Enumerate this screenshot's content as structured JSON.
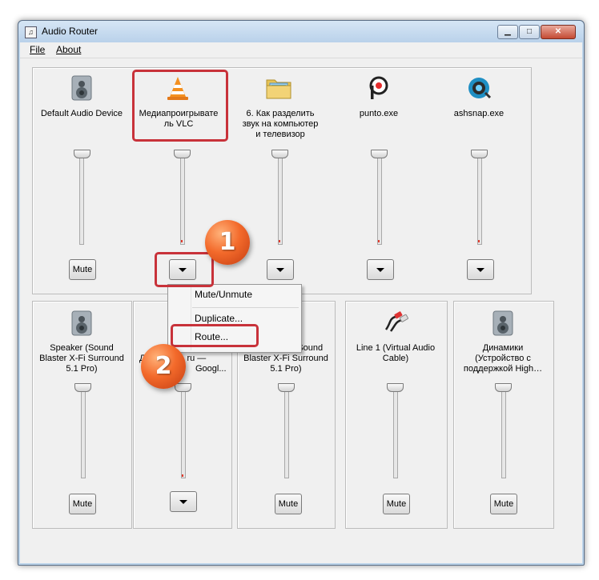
{
  "window": {
    "title": "Audio Router"
  },
  "menu": {
    "file": "File",
    "about": "About"
  },
  "top_devices": [
    {
      "name": "Default Audio Device",
      "control": "Mute",
      "icon": "speaker-icon"
    },
    {
      "name": "Медиапроигрыватель VLC",
      "line1": "Медиапроигрывате",
      "line2": "ль VLC",
      "control": "dropdown",
      "icon": "vlc-cone-icon"
    },
    {
      "name": "6. Как разделить звук на компьютер и телевизор",
      "line1": "6. Как разделить",
      "line2": "звук на компьютер",
      "line3": "и телевизор",
      "control": "dropdown",
      "icon": "folder-icon"
    },
    {
      "name": "punto.exe",
      "control": "dropdown",
      "icon": "punto-icon"
    },
    {
      "name": "ashsnap.exe",
      "control": "dropdown",
      "icon": "ashsnap-icon"
    }
  ],
  "bottom_devices": [
    {
      "line1": "Speaker (Sound",
      "line2": "Blaster X-Fi Surround",
      "line3": "5.1 Pro)",
      "control": "Mute",
      "icon": "speaker-icon"
    },
    {
      "line1": "Д",
      "line1b": "ru —",
      "line2": "Googl...",
      "control": "dropdown",
      "icon": "speaker-icon"
    },
    {
      "line1": "SPDIF-Out (Sound",
      "line2": "Blaster X-Fi Surround",
      "line3": "5.1 Pro)",
      "control": "Mute",
      "icon": "speaker-icon"
    },
    {
      "line1": "Line 1 (Virtual Audio",
      "line2": "Cable)",
      "control": "Mute",
      "icon": "rca-cable-icon"
    },
    {
      "line1": "Динамики",
      "line2": "(Устройство с",
      "line3": "поддержкой High…",
      "control": "Mute",
      "icon": "speaker-icon"
    }
  ],
  "context_menu": {
    "items": [
      "Mute/Unmute",
      "Duplicate...",
      "Route..."
    ]
  },
  "annotations": {
    "step1": "1",
    "step2": "2"
  },
  "colors": {
    "highlight": "#c8323a",
    "badge": "#f36a2b"
  }
}
